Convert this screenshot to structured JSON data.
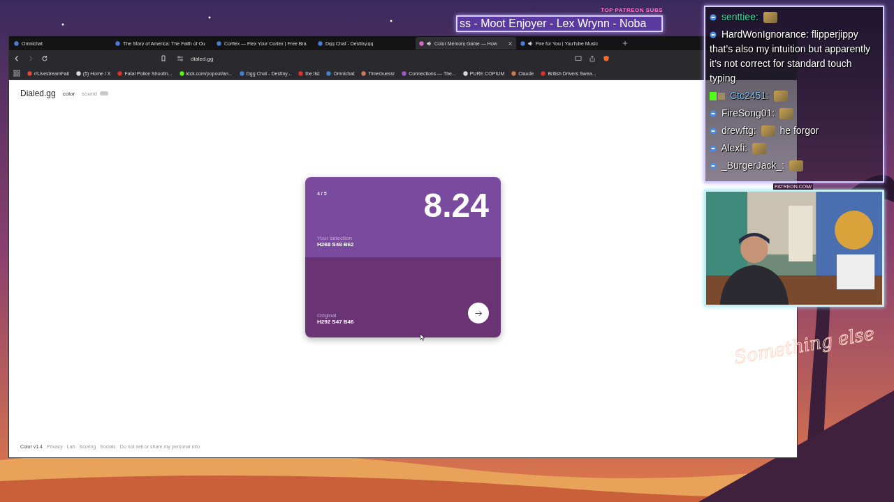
{
  "ticker": {
    "heading": "TOP PATREON SUBS",
    "text": "ss - Moot Enjoyer - Lex Wrynn -  Noba"
  },
  "browser": {
    "tabs": [
      {
        "title": "Omnichat",
        "selected": false,
        "audio": false
      },
      {
        "title": "The Story of America: The Faith of Ou",
        "selected": false,
        "audio": false
      },
      {
        "title": "Corflex — Flex Your Cortex | Free Bra",
        "selected": false,
        "audio": false
      },
      {
        "title": "Dgg Chat - Destiny.gg",
        "selected": false,
        "audio": false
      },
      {
        "title": "Color Memory Game — How",
        "selected": true,
        "audio": true
      },
      {
        "title": "Fire for You | YouTube Music",
        "selected": false,
        "audio": true
      }
    ],
    "address": "dialed.gg",
    "bookmarks": [
      "r/LivestreamFail",
      "(5) Home / X",
      "Fatal Police Shootin...",
      "kick.com/popout/an...",
      "Dgg Chat - Destiny...",
      "the list",
      "Omnichat",
      "TimeGuessr",
      "Connections — The...",
      "PURE  COPIUM",
      "Claude",
      "British Drivers Swea..."
    ]
  },
  "page": {
    "logo": "Dialed.gg",
    "nav": [
      {
        "label": "color",
        "selected": true
      },
      {
        "label": "sound",
        "selected": false
      }
    ],
    "card": {
      "round": "4 / 5",
      "score": "8.24",
      "selection_label": "Your selection",
      "selection_value": "H268 S48 B62",
      "original_label": "Original",
      "original_value": "H292 S47 B46"
    },
    "footer": [
      "Color v1.4",
      "Privacy",
      "Lab",
      "Scoring",
      "Socials",
      "Do not sell or share my personal info"
    ]
  },
  "chat": [
    {
      "kind": "default",
      "user": "senttiee:",
      "color": "#38e0b0",
      "emote_before": true
    },
    {
      "kind": "default",
      "user": "HardWonIgnorance:",
      "color": "#ffffff",
      "emote_before": false,
      "text": "flipperjippy that’s also my intuition but apparently it’s not correct for standard touch typing"
    },
    {
      "kind": "kick",
      "user": "Ctc2451:",
      "color": "#7cc4f4",
      "emote_before": true
    },
    {
      "kind": "default",
      "user": "FireSong01:",
      "color": "#f2f2f2",
      "emote_before": true
    },
    {
      "kind": "default",
      "user": "drewftg:",
      "color": "#f2f2f2",
      "emote_before": true,
      "text": "he forgor"
    },
    {
      "kind": "default",
      "user": "Alexfi:",
      "color": "#f2f2f2",
      "emote_before": true
    },
    {
      "kind": "default",
      "user": "_BurgerJack_:",
      "color": "#f2f2f2",
      "emote_before": true
    }
  ],
  "webcam": {
    "caption": "PATREON.COM/"
  },
  "signature": "Something else"
}
